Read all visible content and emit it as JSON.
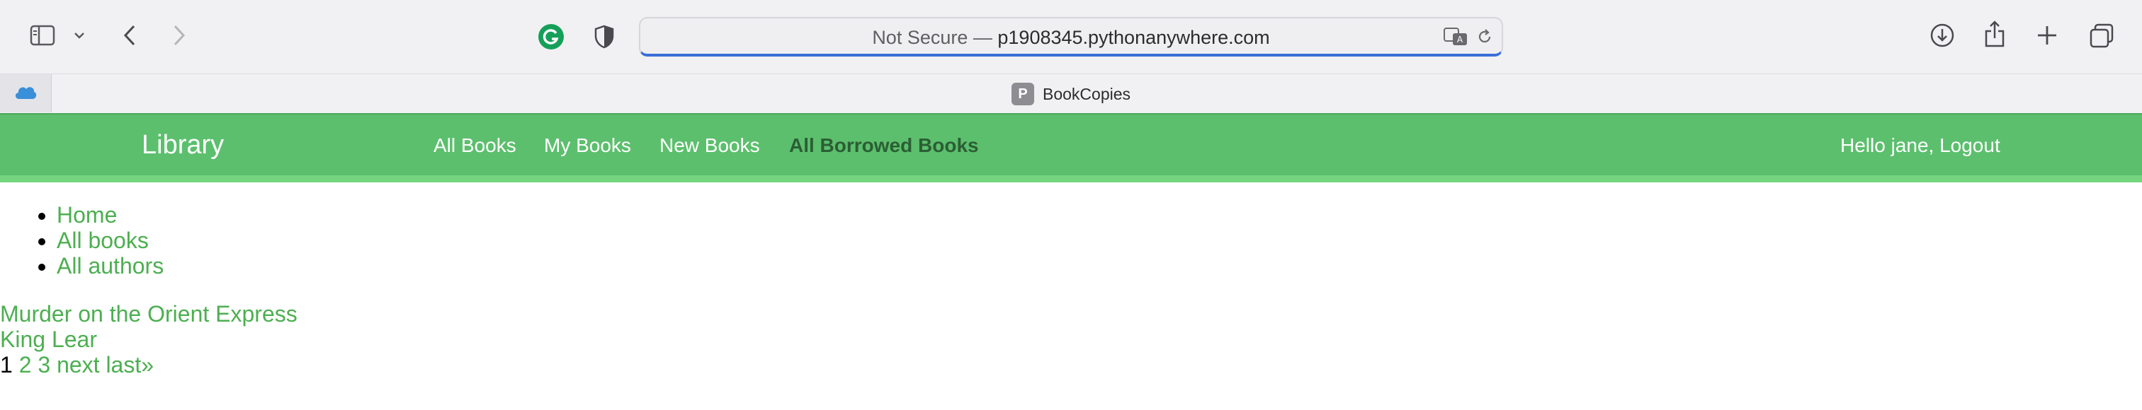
{
  "browser": {
    "url_prefix": "Not Secure — ",
    "url_host": "p1908345.pythonanywhere.com",
    "tab_title": "BookCopies",
    "tab_favicon_letter": "P"
  },
  "navbar": {
    "brand": "Library",
    "links": [
      {
        "label": "All Books"
      },
      {
        "label": "My Books"
      },
      {
        "label": "New Books"
      },
      {
        "label": "All Borrowed Books"
      }
    ],
    "user_text": "Hello jane, Logout",
    "colors": {
      "background": "#5cbf6d",
      "active_link": "#2b5e34",
      "link": "#ffffff"
    }
  },
  "sidebar": {
    "items": [
      {
        "label": "Home"
      },
      {
        "label": "All books"
      },
      {
        "label": "All authors"
      }
    ]
  },
  "books": [
    {
      "title": "Murder on the Orient Express"
    },
    {
      "title": "King Lear"
    }
  ],
  "pagination": {
    "current": "1",
    "pages": [
      "2",
      "3"
    ],
    "next": "next",
    "last": "last»"
  },
  "icons": [
    "sidebar-toggle-icon",
    "chevron-down-icon",
    "back-icon",
    "forward-icon",
    "grammarly-icon",
    "privacy-shield-icon",
    "translate-icon",
    "reload-icon",
    "download-icon",
    "share-icon",
    "new-tab-icon",
    "tab-overview-icon",
    "cloud-icon"
  ],
  "theme": {
    "link_color": "#4caf50",
    "url_focus": "#3a6fd8"
  }
}
